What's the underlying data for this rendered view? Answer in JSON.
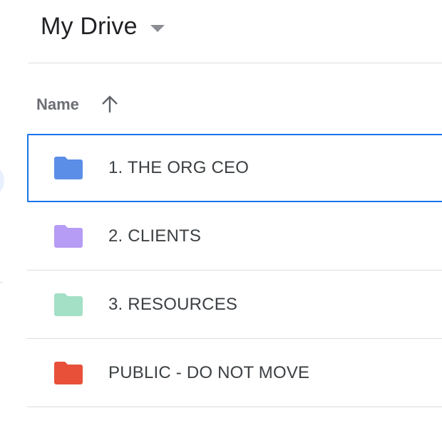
{
  "header": {
    "title": "My Drive",
    "dropdown_icon": "caret-down-icon"
  },
  "columns": {
    "name_label": "Name",
    "sort_icon": "arrow-up-icon",
    "sort_direction": "ascending"
  },
  "folders": [
    {
      "name": "1. THE ORG CEO",
      "color": "#5b8ee6",
      "selected": true
    },
    {
      "name": "2. CLIENTS",
      "color": "#b69cf4",
      "selected": false
    },
    {
      "name": "3. RESOURCES",
      "color": "#a3e0c6",
      "selected": false
    },
    {
      "name": "PUBLIC - DO NOT MOVE",
      "color": "#e8503a",
      "selected": false
    }
  ],
  "colors": {
    "selection_border": "#1a73e8",
    "divider": "#dadce0",
    "title_text": "#202124",
    "row_text": "#3c4043"
  }
}
